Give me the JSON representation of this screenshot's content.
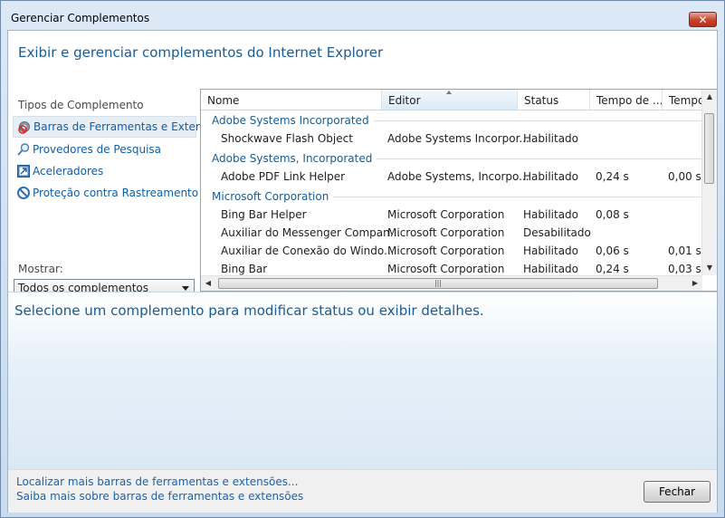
{
  "window": {
    "title": "Gerenciar Complementos",
    "close_glyph": "✕"
  },
  "header": {
    "heading": "Exibir e gerenciar complementos do Internet Explorer"
  },
  "sidebar": {
    "types_label": "Tipos de Complemento",
    "items": [
      {
        "label": "Barras de Ferramentas e Extensões",
        "icon": "gear-icon",
        "selected": true
      },
      {
        "label": "Provedores de Pesquisa",
        "icon": "search-icon",
        "selected": false
      },
      {
        "label": "Aceleradores",
        "icon": "accelerator-icon",
        "selected": false
      },
      {
        "label": "Proteção contra Rastreamento",
        "icon": "block-icon",
        "selected": false
      }
    ],
    "show_label": "Mostrar:",
    "show_value": "Todos os complementos"
  },
  "table": {
    "columns": [
      "Nome",
      "Editor",
      "Status",
      "Tempo de ...",
      "Tempo"
    ],
    "sorted_column": "Editor",
    "groups": [
      {
        "name": "Adobe Systems Incorporated",
        "rows": [
          {
            "name": "Shockwave Flash Object",
            "publisher": "Adobe Systems Incorpor...",
            "status": "Habilitado",
            "load": "",
            "nav": ""
          }
        ]
      },
      {
        "name": "Adobe Systems, Incorporated",
        "rows": [
          {
            "name": "Adobe PDF Link Helper",
            "publisher": "Adobe Systems, Incorpo...",
            "status": "Habilitado",
            "load": "0,24 s",
            "nav": "0,00 s"
          }
        ]
      },
      {
        "name": "Microsoft Corporation",
        "rows": [
          {
            "name": "Bing Bar Helper",
            "publisher": "Microsoft Corporation",
            "status": "Habilitado",
            "load": "0,08 s",
            "nav": ""
          },
          {
            "name": "Auxiliar do Messenger Compan...",
            "publisher": "Microsoft Corporation",
            "status": "Desabilitado",
            "load": "",
            "nav": ""
          },
          {
            "name": "Auxiliar de Conexão do Windo...",
            "publisher": "Microsoft Corporation",
            "status": "Habilitado",
            "load": "0,06 s",
            "nav": "0,01 s"
          },
          {
            "name": "Bing Bar",
            "publisher": "Microsoft Corporation",
            "status": "Habilitado",
            "load": "0,24 s",
            "nav": "0,03 s"
          }
        ]
      }
    ]
  },
  "details": {
    "message": "Selecione um complemento para modificar status ou exibir detalhes."
  },
  "footer": {
    "link1": "Localizar mais barras de ferramentas e extensões...",
    "link2": "Saiba mais sobre barras de ferramentas e extensões",
    "close_button": "Fechar"
  },
  "colors": {
    "heading": "#1b5b91",
    "link": "#1a63b0",
    "close": "#c6432b"
  }
}
